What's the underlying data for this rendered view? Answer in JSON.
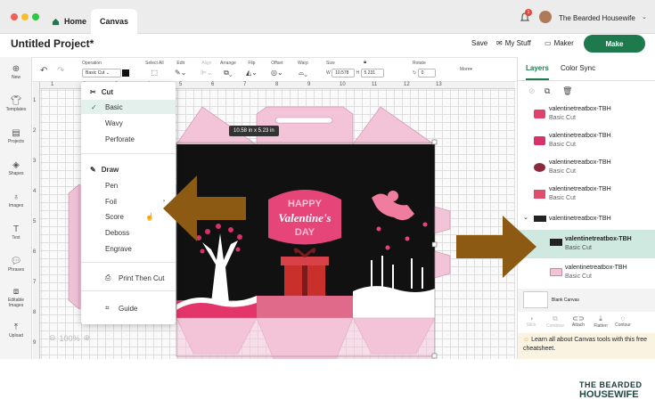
{
  "window": {
    "home_tab": "Home",
    "canvas_tab": "Canvas",
    "user_name": "The Bearded Housewife",
    "notification_count": "1"
  },
  "header": {
    "project_title": "Untitled Project*",
    "save": "Save",
    "my_stuff": "My Stuff",
    "maker": "Maker",
    "make": "Make"
  },
  "toolbar": {
    "operation_label": "Operation",
    "operation_value": "Basic Cut",
    "select_all": "Select All",
    "edit": "Edit",
    "align": "Align",
    "arrange": "Arrange",
    "flip": "Flip",
    "offset": "Offset",
    "warp": "Warp",
    "size": "Size",
    "w_label": "W",
    "w_value": "10.578",
    "h_label": "H",
    "h_value": "5.231",
    "rotate": "Rotate",
    "rotate_value": "0",
    "more": "More"
  },
  "left_nav": [
    {
      "label": "New",
      "icon": "plus-circle-icon"
    },
    {
      "label": "Templates",
      "icon": "shirt-icon"
    },
    {
      "label": "Projects",
      "icon": "clipboard-icon"
    },
    {
      "label": "Shapes",
      "icon": "shapes-icon"
    },
    {
      "label": "Images",
      "icon": "bulb-icon"
    },
    {
      "label": "Text",
      "icon": "text-icon"
    },
    {
      "label": "Phrases",
      "icon": "speech-icon"
    },
    {
      "label": "Editable Images",
      "icon": "editable-icon"
    },
    {
      "label": "Upload",
      "icon": "upload-icon"
    }
  ],
  "ruler": {
    "top": [
      "1",
      "2",
      "3",
      "4",
      "5",
      "6",
      "7",
      "8",
      "9",
      "10",
      "11",
      "12",
      "13"
    ],
    "left": [
      "1",
      "2",
      "3",
      "4",
      "5",
      "6",
      "7",
      "8",
      "9"
    ]
  },
  "size_tooltip": "10.58  in x 5.23  in",
  "zoom": "100%",
  "menu": {
    "cut_header": "Cut",
    "cut_items": [
      "Basic",
      "Wavy",
      "Perforate"
    ],
    "draw_header": "Draw",
    "draw_items": [
      "Pen",
      "Foil",
      "Score",
      "Deboss",
      "Engrave"
    ],
    "print_then_cut": "Print Then Cut",
    "guide": "Guide"
  },
  "design": {
    "text_line1": "HAPPY",
    "text_line2": "Valentine's",
    "text_line3": "DAY"
  },
  "panel": {
    "tab_layers": "Layers",
    "tab_color_sync": "Color Sync",
    "layers": [
      {
        "name": "valentinetreatbox-TBH",
        "type": "Basic Cut",
        "color": "#e0426e"
      },
      {
        "name": "valentinetreatbox-TBH",
        "type": "Basic Cut",
        "color": "#d8306a"
      },
      {
        "name": "valentinetreatbox-TBH",
        "type": "Basic Cut",
        "color": "#8a2a3c"
      },
      {
        "name": "valentinetreatbox-TBH",
        "type": "Basic Cut",
        "color": "#e04c6c"
      }
    ],
    "group_name": "valentinetreatbox-TBH",
    "selected_layer": {
      "name": "valentinetreatbox-TBH",
      "type": "Basic Cut"
    },
    "last_layer": {
      "name": "valentinetreatbox-TBH",
      "type": "Basic Cut"
    },
    "blank_canvas": "Blank Canvas",
    "actions": [
      "Slice",
      "Combine",
      "Attach",
      "Flatten",
      "Contour"
    ],
    "tip": "Learn all about Canvas tools with this free cheatsheet."
  },
  "logo": {
    "line1": "THE BEARDED",
    "line2": "HOUSEWIFE"
  }
}
